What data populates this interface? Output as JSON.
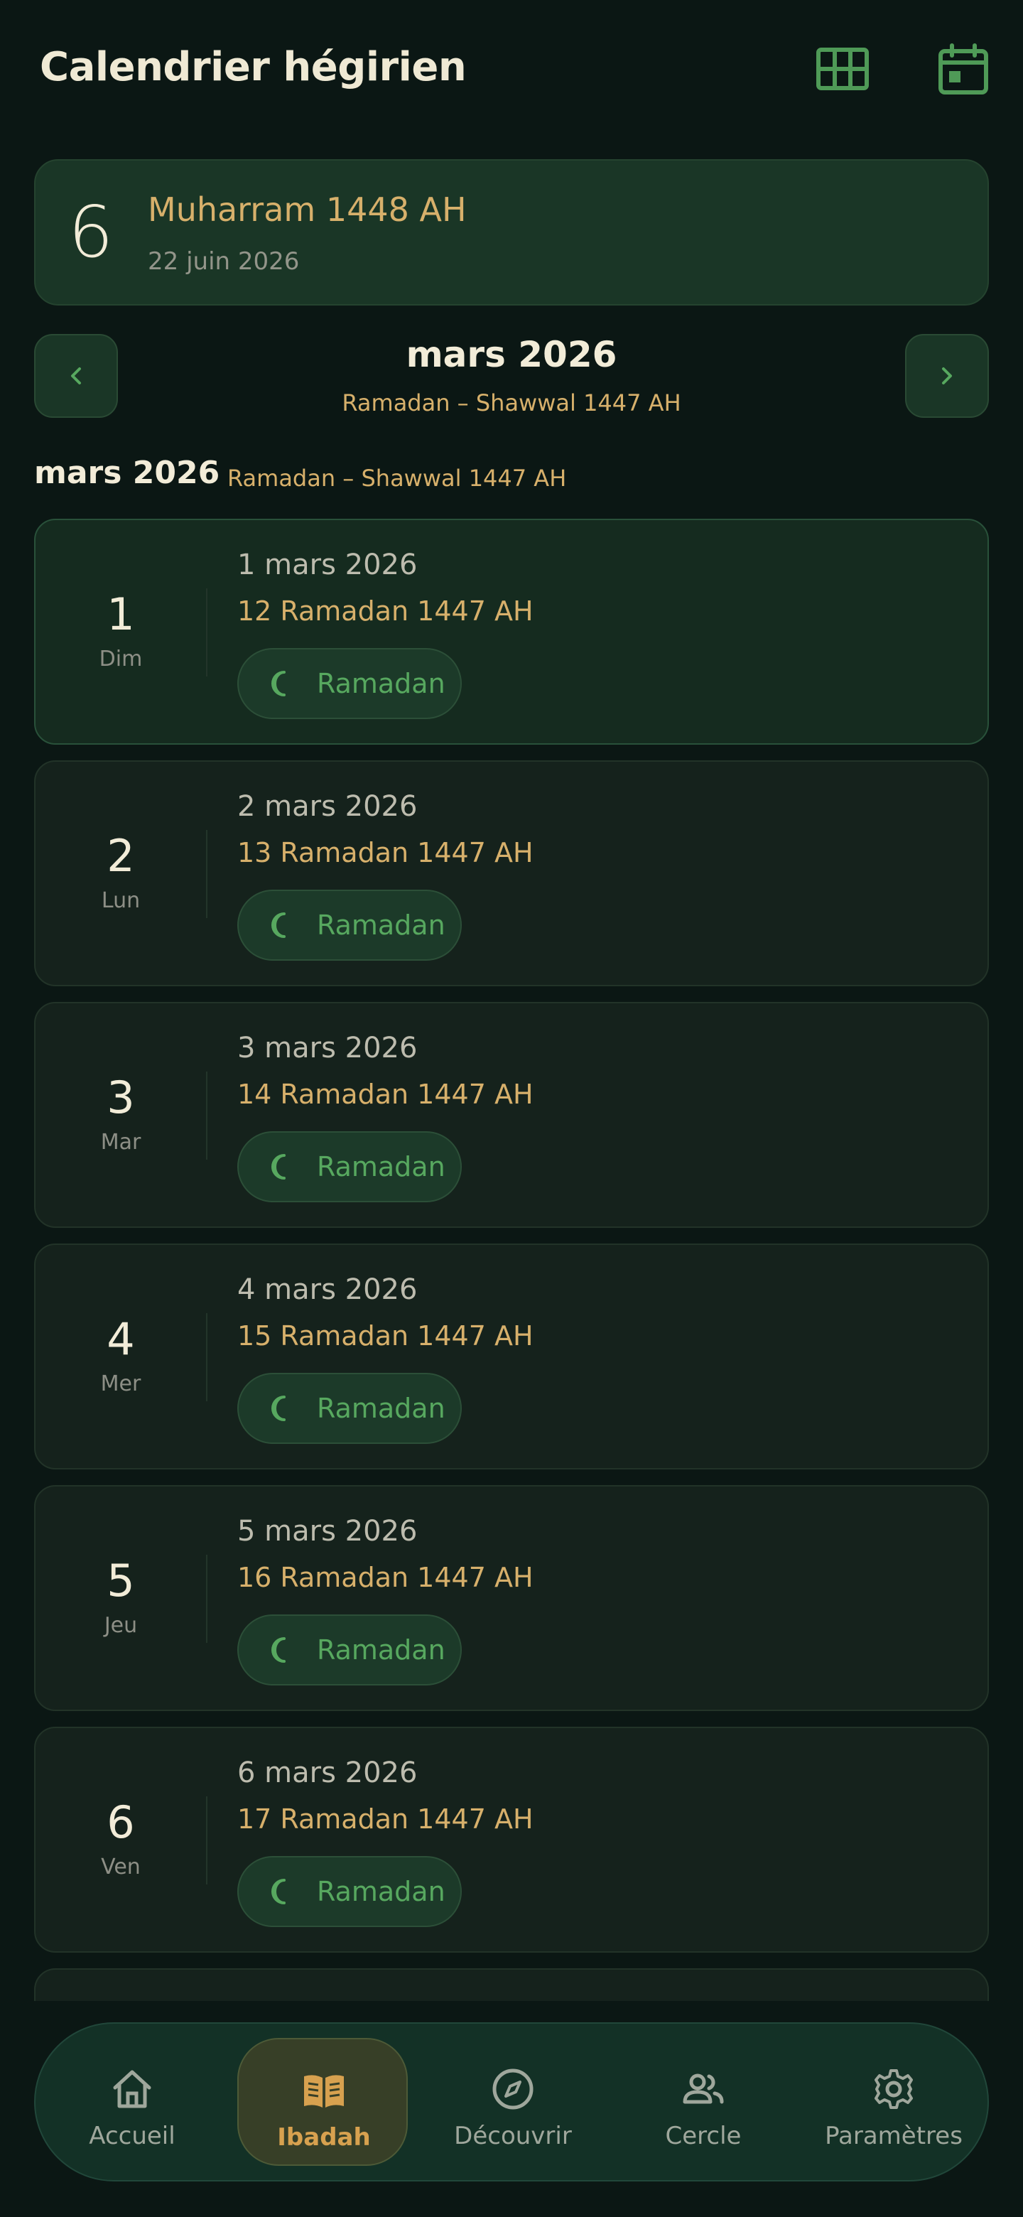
{
  "header": {
    "title": "Calendrier hégirien",
    "icons": [
      "grid-icon",
      "calendar-icon"
    ]
  },
  "today": {
    "day": "6",
    "hijri": "Muharram 1448 AH",
    "gregorian": "22 juin 2026"
  },
  "month_nav": {
    "month": "mars 2026",
    "hijri_range": "Ramadan – Shawwal 1447 AH",
    "prev_icon": "chevron-left-icon",
    "next_icon": "chevron-right-icon"
  },
  "section": {
    "month": "mars 2026",
    "hijri_range": "Ramadan – Shawwal 1447 AH"
  },
  "days": [
    {
      "num": "1",
      "weekday": "Dim",
      "gregorian": "1 mars 2026",
      "hijri": "12 Ramadan 1447 AH",
      "tag": "Ramadan"
    },
    {
      "num": "2",
      "weekday": "Lun",
      "gregorian": "2 mars 2026",
      "hijri": "13 Ramadan 1447 AH",
      "tag": "Ramadan"
    },
    {
      "num": "3",
      "weekday": "Mar",
      "gregorian": "3 mars 2026",
      "hijri": "14 Ramadan 1447 AH",
      "tag": "Ramadan"
    },
    {
      "num": "4",
      "weekday": "Mer",
      "gregorian": "4 mars 2026",
      "hijri": "15 Ramadan 1447 AH",
      "tag": "Ramadan"
    },
    {
      "num": "5",
      "weekday": "Jeu",
      "gregorian": "5 mars 2026",
      "hijri": "16 Ramadan 1447 AH",
      "tag": "Ramadan"
    },
    {
      "num": "6",
      "weekday": "Ven",
      "gregorian": "6 mars 2026",
      "hijri": "17 Ramadan 1447 AH",
      "tag": "Ramadan"
    }
  ],
  "bottom_nav": {
    "items": [
      {
        "label": "Accueil",
        "icon": "home-icon"
      },
      {
        "label": "Ibadah",
        "icon": "book-icon",
        "active": true
      },
      {
        "label": "Découvrir",
        "icon": "compass-icon"
      },
      {
        "label": "Cercle",
        "icon": "people-icon"
      },
      {
        "label": "Paramètres",
        "icon": "gear-icon"
      }
    ]
  },
  "colors": {
    "background": "#0b1714",
    "accent_green": "#57a85f",
    "accent_gold": "#d7b06b",
    "active_tab": "#d7a14f"
  }
}
